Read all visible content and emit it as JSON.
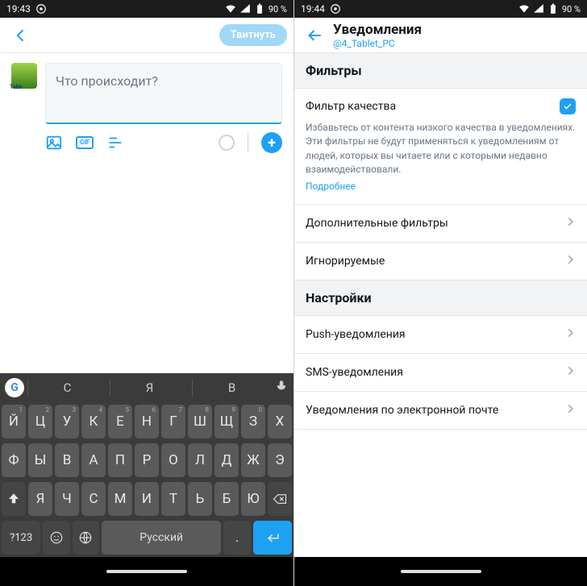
{
  "left": {
    "status": {
      "time": "19:43",
      "battery": "90 %"
    },
    "appbar": {
      "tweet_label": "Твитнуть"
    },
    "compose": {
      "placeholder": "Что происходит?",
      "gif_label": "GIF"
    },
    "keyboard": {
      "suggestions": [
        "С",
        "Я",
        "В"
      ],
      "row1": [
        {
          "ch": "Й",
          "n": "1"
        },
        {
          "ch": "Ц",
          "n": "2"
        },
        {
          "ch": "У",
          "n": "3"
        },
        {
          "ch": "К",
          "n": "4"
        },
        {
          "ch": "Е",
          "n": "5"
        },
        {
          "ch": "Н",
          "n": "6"
        },
        {
          "ch": "Г",
          "n": "7"
        },
        {
          "ch": "Ш",
          "n": "8"
        },
        {
          "ch": "Щ",
          "n": "9"
        },
        {
          "ch": "З",
          "n": "0"
        },
        {
          "ch": "Х",
          "n": ""
        }
      ],
      "row2": [
        "Ф",
        "Ы",
        "В",
        "А",
        "П",
        "Р",
        "О",
        "Л",
        "Д",
        "Ж",
        "Э"
      ],
      "row3": [
        "Я",
        "Ч",
        "С",
        "М",
        "И",
        "Т",
        "Ь",
        "Б",
        "Ю"
      ],
      "numbers_label": "?123",
      "space_label": "Русский"
    }
  },
  "right": {
    "status": {
      "time": "19:44",
      "battery": "90 %"
    },
    "appbar": {
      "title": "Уведомления",
      "subtitle": "@4_Tablet_PC"
    },
    "sections": {
      "filters_header": "Фильтры",
      "quality": {
        "label": "Фильтр качества",
        "desc": "Избавьтесь от контента низкого качества в уведомлениях. Эти фильтры не будут применяться к уведомлениям от людей, которых вы читаете или с которыми недавно взаимодействовали.",
        "more": "Подробнее"
      },
      "additional_filters": "Дополнительные фильтры",
      "muted": "Игнорируемые",
      "settings_header": "Настройки",
      "push": "Push-уведомления",
      "sms": "SMS-уведомления",
      "email": "Уведомления по электронной почте"
    }
  }
}
